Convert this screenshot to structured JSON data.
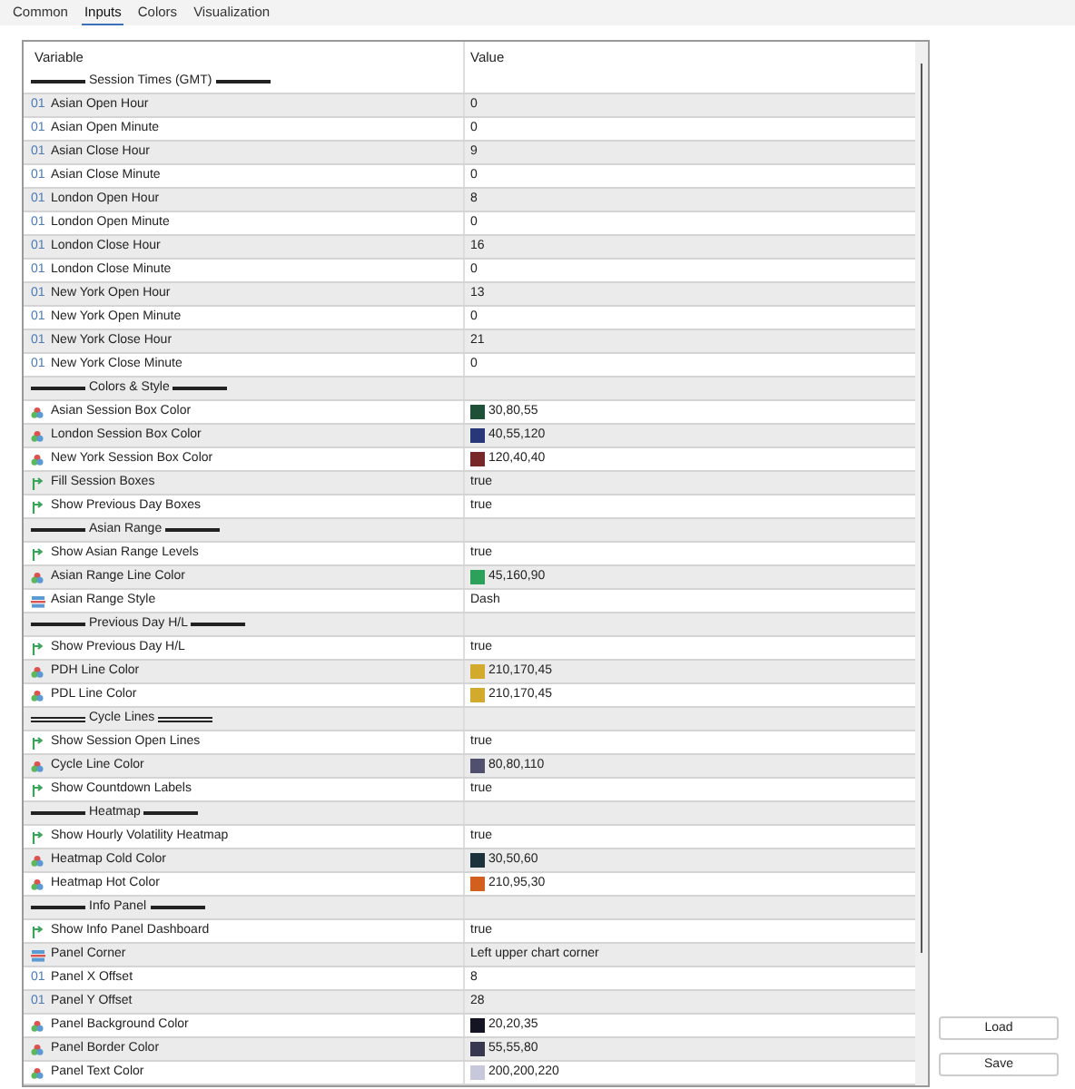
{
  "tabs": [
    {
      "label": "Common",
      "selected": false
    },
    {
      "label": "Inputs",
      "selected": true
    },
    {
      "label": "Colors",
      "selected": false
    },
    {
      "label": "Visualization",
      "selected": false
    }
  ],
  "table": {
    "columns": [
      "Variable",
      "Value"
    ],
    "rows": [
      {
        "kind": "separator",
        "label": "Session Times (GMT)",
        "double_rule": false
      },
      {
        "kind": "int",
        "badge": "01",
        "label": "Asian Open Hour",
        "value": "0"
      },
      {
        "kind": "int",
        "badge": "01",
        "label": "Asian Open Minute",
        "value": "0"
      },
      {
        "kind": "int",
        "badge": "01",
        "label": "Asian Close Hour",
        "value": "9"
      },
      {
        "kind": "int",
        "badge": "01",
        "label": "Asian Close Minute",
        "value": "0"
      },
      {
        "kind": "int",
        "badge": "01",
        "label": "London Open Hour",
        "value": "8"
      },
      {
        "kind": "int",
        "badge": "01",
        "label": "London Open Minute",
        "value": "0"
      },
      {
        "kind": "int",
        "badge": "01",
        "label": "London Close Hour",
        "value": "16"
      },
      {
        "kind": "int",
        "badge": "01",
        "label": "London Close Minute",
        "value": "0"
      },
      {
        "kind": "int",
        "badge": "01",
        "label": "New York Open Hour",
        "value": "13"
      },
      {
        "kind": "int",
        "badge": "01",
        "label": "New York Open Minute",
        "value": "0"
      },
      {
        "kind": "int",
        "badge": "01",
        "label": "New York Close Hour",
        "value": "21"
      },
      {
        "kind": "int",
        "badge": "01",
        "label": "New York Close Minute",
        "value": "0"
      },
      {
        "kind": "separator",
        "label": "Colors & Style",
        "double_rule": false
      },
      {
        "kind": "color",
        "label": "Asian Session Box Color",
        "value": "30,80,55",
        "color": "#1e5037"
      },
      {
        "kind": "color",
        "label": "London Session Box Color",
        "value": "40,55,120",
        "color": "#283778"
      },
      {
        "kind": "color",
        "label": "New York Session Box Color",
        "value": "120,40,40",
        "color": "#782828"
      },
      {
        "kind": "bool",
        "label": "Fill Session Boxes",
        "value": "true"
      },
      {
        "kind": "bool",
        "label": "Show Previous Day Boxes",
        "value": "true"
      },
      {
        "kind": "separator",
        "label": "Asian Range",
        "double_rule": false
      },
      {
        "kind": "bool",
        "label": "Show Asian Range Levels",
        "value": "true"
      },
      {
        "kind": "color",
        "label": "Asian Range Line Color",
        "value": "45,160,90",
        "color": "#2da05a"
      },
      {
        "kind": "enum",
        "label": "Asian Range Style",
        "value": "Dash"
      },
      {
        "kind": "separator",
        "label": "Previous Day H/L",
        "double_rule": false
      },
      {
        "kind": "bool",
        "label": "Show Previous Day H/L",
        "value": "true"
      },
      {
        "kind": "color",
        "label": "PDH Line Color",
        "value": "210,170,45",
        "color": "#d2aa2d"
      },
      {
        "kind": "color",
        "label": "PDL Line Color",
        "value": "210,170,45",
        "color": "#d2aa2d"
      },
      {
        "kind": "separator",
        "label": "Cycle Lines",
        "double_rule": true
      },
      {
        "kind": "bool",
        "label": "Show Session Open Lines",
        "value": "true"
      },
      {
        "kind": "color",
        "label": "Cycle Line Color",
        "value": "80,80,110",
        "color": "#50506e"
      },
      {
        "kind": "bool",
        "label": "Show Countdown Labels",
        "value": "true"
      },
      {
        "kind": "separator",
        "label": "Heatmap",
        "double_rule": false
      },
      {
        "kind": "bool",
        "label": "Show Hourly Volatility Heatmap",
        "value": "true"
      },
      {
        "kind": "color",
        "label": "Heatmap Cold Color",
        "value": "30,50,60",
        "color": "#1e323c"
      },
      {
        "kind": "color",
        "label": "Heatmap Hot Color",
        "value": "210,95,30",
        "color": "#d25f1e"
      },
      {
        "kind": "separator",
        "label": "Info Panel",
        "double_rule": false
      },
      {
        "kind": "bool",
        "label": "Show Info Panel Dashboard",
        "value": "true"
      },
      {
        "kind": "enum",
        "label": "Panel Corner",
        "value": "Left upper chart corner"
      },
      {
        "kind": "int",
        "badge": "01",
        "label": "Panel X Offset",
        "value": "8"
      },
      {
        "kind": "int",
        "badge": "01",
        "label": "Panel Y Offset",
        "value": "28"
      },
      {
        "kind": "color",
        "label": "Panel Background Color",
        "value": "20,20,35",
        "color": "#141423"
      },
      {
        "kind": "color",
        "label": "Panel Border Color",
        "value": "55,55,80",
        "color": "#373750"
      },
      {
        "kind": "color",
        "label": "Panel Text Color",
        "value": "200,200,220",
        "color": "#c8c8dc"
      }
    ]
  },
  "buttons": [
    "Load",
    "Save"
  ]
}
